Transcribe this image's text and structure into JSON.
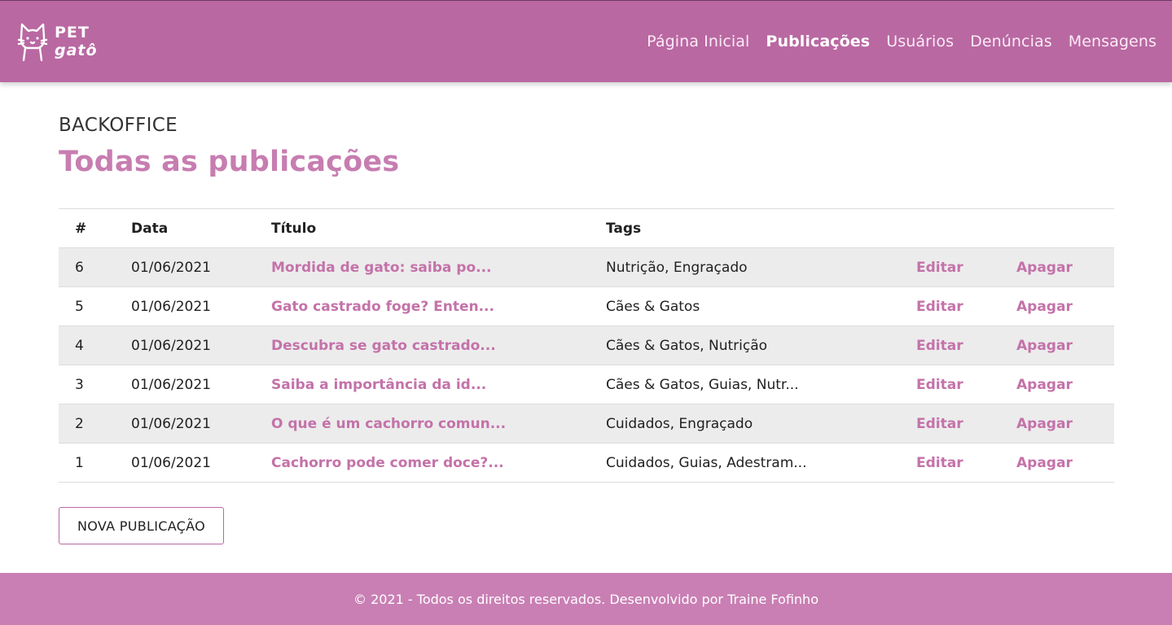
{
  "brand": {
    "line1": "PET",
    "line2": "gatô",
    "logo_icon": "cat-head-icon"
  },
  "nav": {
    "items": [
      {
        "label": "Página Inicial",
        "active": false
      },
      {
        "label": "Publicações",
        "active": true
      },
      {
        "label": "Usuários",
        "active": false
      },
      {
        "label": "Denúncias",
        "active": false
      },
      {
        "label": "Mensagens",
        "active": false
      }
    ]
  },
  "header": {
    "eyebrow": "BACKOFFICE",
    "title": "Todas as publicações"
  },
  "table": {
    "columns": [
      "#",
      "Data",
      "Título",
      "Tags",
      "",
      ""
    ],
    "rows": [
      {
        "id": "6",
        "date": "01/06/2021",
        "title": "Mordida de gato: saiba po...",
        "tags": "Nutrição, Engraçado",
        "edit": "Editar",
        "delete": "Apagar"
      },
      {
        "id": "5",
        "date": "01/06/2021",
        "title": "Gato castrado foge? Enten...",
        "tags": "Cães & Gatos",
        "edit": "Editar",
        "delete": "Apagar"
      },
      {
        "id": "4",
        "date": "01/06/2021",
        "title": "Descubra se gato castrado...",
        "tags": "Cães & Gatos, Nutrição",
        "edit": "Editar",
        "delete": "Apagar"
      },
      {
        "id": "3",
        "date": "01/06/2021",
        "title": "Saiba a importância da id...",
        "tags": "Cães & Gatos, Guias, Nutr...",
        "edit": "Editar",
        "delete": "Apagar"
      },
      {
        "id": "2",
        "date": "01/06/2021",
        "title": "O que é um cachorro comun...",
        "tags": "Cuidados, Engraçado",
        "edit": "Editar",
        "delete": "Apagar"
      },
      {
        "id": "1",
        "date": "01/06/2021",
        "title": "Cachorro pode comer doce?...",
        "tags": "Cuidados, Guias, Adestram...",
        "edit": "Editar",
        "delete": "Apagar"
      }
    ]
  },
  "actions": {
    "new_post": "NOVA PUBLICAÇÃO"
  },
  "footer": {
    "text": "© 2021 - Todos os direitos reservados. Desenvolvido por Traine Fofinho"
  },
  "colors": {
    "brand": "#b968a2",
    "accent": "#c472a9",
    "footer": "#c97fb4",
    "row_stripe": "#ececec"
  }
}
